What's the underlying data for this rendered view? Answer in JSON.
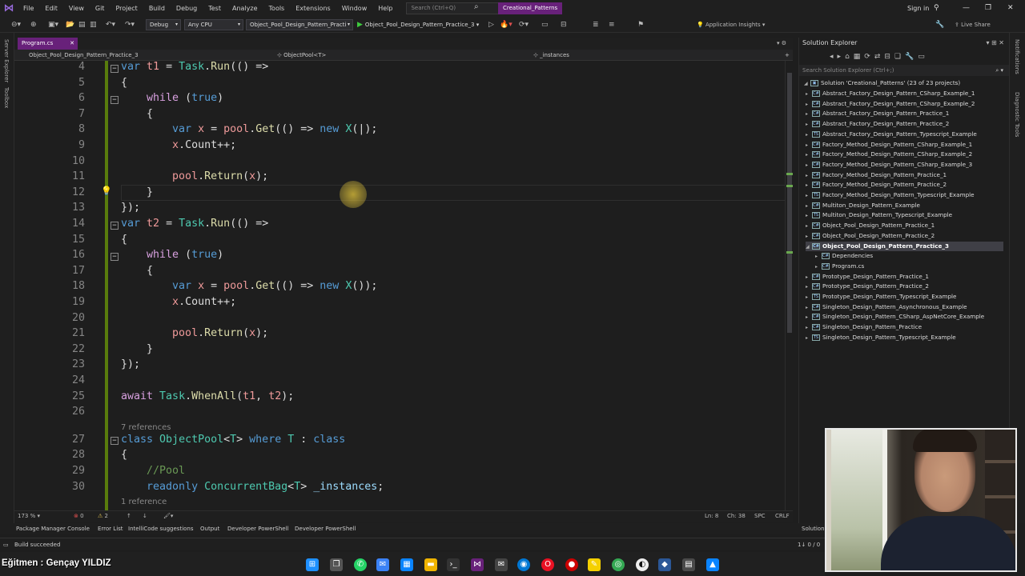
{
  "menubar": {
    "items": [
      "File",
      "Edit",
      "View",
      "Git",
      "Project",
      "Build",
      "Debug",
      "Test",
      "Analyze",
      "Tools",
      "Extensions",
      "Window",
      "Help"
    ],
    "search_placeholder": "Search (Ctrl+Q)",
    "solution_name": "Creational_Patterns",
    "sign_in": "Sign in"
  },
  "toolbar": {
    "config": "Debug",
    "platform": "Any CPU",
    "startup_project": "Object_Pool_Design_Pattern_Practi",
    "run_target": "Object_Pool_Design_Pattern_Practice_3",
    "app_insights": "Application Insights",
    "live_share": "Live Share"
  },
  "left_strip": [
    "Server Explorer",
    "Toolbox"
  ],
  "right_strip": [
    "Notifications",
    "Diagnostic Tools"
  ],
  "editor": {
    "tab": "Program.cs",
    "nav_project": "Object_Pool_Design_Pattern_Practice_3",
    "nav_type": "ObjectPool<T>",
    "nav_member": "_instances",
    "lines": [
      {
        "n": "4",
        "html": "<span class='k'>var</span> <span class='lv'>t1</span> <span class='p'>=</span> <span class='t'>Task</span><span class='p'>.</span><span class='m'>Run</span><span class='p'>(() =&gt;</span>"
      },
      {
        "n": "5",
        "html": "<span class='p'>{</span>"
      },
      {
        "n": "6",
        "html": "    <span class='kc'>while</span> <span class='p'>(</span><span class='k'>true</span><span class='p'>)</span>"
      },
      {
        "n": "7",
        "html": "    <span class='p'>{</span>"
      },
      {
        "n": "8",
        "html": "        <span class='k'>var</span> <span class='lv'>x</span> <span class='p'>=</span> <span class='lv'>pool</span><span class='p'>.</span><span class='m'>Get</span><span class='p'>(() =&gt;</span> <span class='k'>new</span> <span class='t'>X</span><span class='p'>(|);</span>"
      },
      {
        "n": "9",
        "html": "        <span class='lv'>x</span><span class='p'>.Count++;</span>"
      },
      {
        "n": "10",
        "html": ""
      },
      {
        "n": "11",
        "html": "        <span class='lv'>pool</span><span class='p'>.</span><span class='m'>Return</span><span class='p'>(</span><span class='lv'>x</span><span class='p'>);</span>"
      },
      {
        "n": "12",
        "html": "    <span class='p'>}</span>"
      },
      {
        "n": "13",
        "html": "<span class='p'>});</span>"
      },
      {
        "n": "14",
        "html": "<span class='k'>var</span> <span class='lv'>t2</span> <span class='p'>=</span> <span class='t'>Task</span><span class='p'>.</span><span class='m'>Run</span><span class='p'>(() =&gt;</span>"
      },
      {
        "n": "15",
        "html": "<span class='p'>{</span>"
      },
      {
        "n": "16",
        "html": "    <span class='kc'>while</span> <span class='p'>(</span><span class='k'>true</span><span class='p'>)</span>"
      },
      {
        "n": "17",
        "html": "    <span class='p'>{</span>"
      },
      {
        "n": "18",
        "html": "        <span class='k'>var</span> <span class='lv'>x</span> <span class='p'>=</span> <span class='lv'>pool</span><span class='p'>.</span><span class='m'>Get</span><span class='p'>(() =&gt;</span> <span class='k'>new</span> <span class='t'>X</span><span class='p'>());</span>"
      },
      {
        "n": "19",
        "html": "        <span class='lv'>x</span><span class='p'>.Count++;</span>"
      },
      {
        "n": "20",
        "html": ""
      },
      {
        "n": "21",
        "html": "        <span class='lv'>pool</span><span class='p'>.</span><span class='m'>Return</span><span class='p'>(</span><span class='lv'>x</span><span class='p'>);</span>"
      },
      {
        "n": "22",
        "html": "    <span class='p'>}</span>"
      },
      {
        "n": "23",
        "html": "<span class='p'>});</span>"
      },
      {
        "n": "24",
        "html": ""
      },
      {
        "n": "25",
        "html": "<span class='kc'>await</span> <span class='t'>Task</span><span class='p'>.</span><span class='m'>WhenAll</span><span class='p'>(</span><span class='lv'>t1</span><span class='p'>,</span> <span class='lv'>t2</span><span class='p'>);</span>"
      },
      {
        "n": "26",
        "html": ""
      },
      {
        "n": "27",
        "html": "<span class='k'>class</span> <span class='t'>ObjectPool</span><span class='p'>&lt;</span><span class='t'>T</span><span class='p'>&gt;</span> <span class='k'>where</span> <span class='t'>T</span> <span class='p'>:</span> <span class='k'>class</span>"
      },
      {
        "n": "28",
        "html": "<span class='p'>{</span>"
      },
      {
        "n": "29",
        "html": "    <span class='c'>//Pool</span>"
      },
      {
        "n": "30",
        "html": "    <span class='k'>readonly</span> <span class='t'>ConcurrentBag</span><span class='p'>&lt;</span><span class='t'>T</span><span class='p'>&gt;</span> <span class='v'>_instances</span><span class='p'>;</span>"
      }
    ],
    "codelens_refs_class": "7 references",
    "codelens_refs_field": "1 reference"
  },
  "editor_status": {
    "zoom": "173 %",
    "errors": "0",
    "warnings": "2",
    "line": "Ln: 8",
    "col": "Ch: 38",
    "spc": "SPC",
    "eol": "CRLF"
  },
  "solution_explorer": {
    "title": "Solution Explorer",
    "search_placeholder": "Search Solution Explorer (Ctrl+;)",
    "solution": "Solution 'Creational_Patterns' (23 of 23 projects)",
    "projects": [
      "Abstract_Factory_Design_Pattern_CSharp_Example_1",
      "Abstract_Factory_Design_Pattern_CSharp_Example_2",
      "Abstract_Factory_Design_Pattern_Practice_1",
      "Abstract_Factory_Design_Pattern_Practice_2",
      "Abstract_Factory_Design_Pattern_Typescript_Example",
      "Factory_Method_Design_Pattern_CSharp_Example_1",
      "Factory_Method_Design_Pattern_CSharp_Example_2",
      "Factory_Method_Design_Pattern_CSharp_Example_3",
      "Factory_Method_Design_Pattern_Practice_1",
      "Factory_Method_Design_Pattern_Practice_2",
      "Factory_Method_Design_Pattern_Typescript_Example",
      "Multiton_Design_Pattern_Example",
      "Multiton_Design_Pattern_Typescript_Example",
      "Object_Pool_Design_Pattern_Practice_1",
      "Object_Pool_Design_Pattern_Practice_2",
      "Object_Pool_Design_Pattern_Practice_3",
      "Dependencies",
      "Program.cs",
      "Prototype_Design_Pattern_Practice_1",
      "Prototype_Design_Pattern_Practice_2",
      "Prototype_Design_Pattern_Typescript_Example",
      "Singleton_Design_Pattern_Asynchronous_Example",
      "Singleton_Design_Pattern_CSharp_AspNetCore_Example",
      "Singleton_Design_Pattern_Practice",
      "Singleton_Design_Pattern_Typescript_Example"
    ]
  },
  "bottom_tabs": [
    "Package Manager Console",
    "Error List",
    "IntelliCode suggestions",
    "Output",
    "Developer PowerShell",
    "Developer PowerShell"
  ],
  "status": {
    "message": "Build succeeded",
    "right": "1↓ 0 / 0",
    "solution_tab": "Solution"
  },
  "instructor": "Eğitmen : Gençay YILDIZ"
}
